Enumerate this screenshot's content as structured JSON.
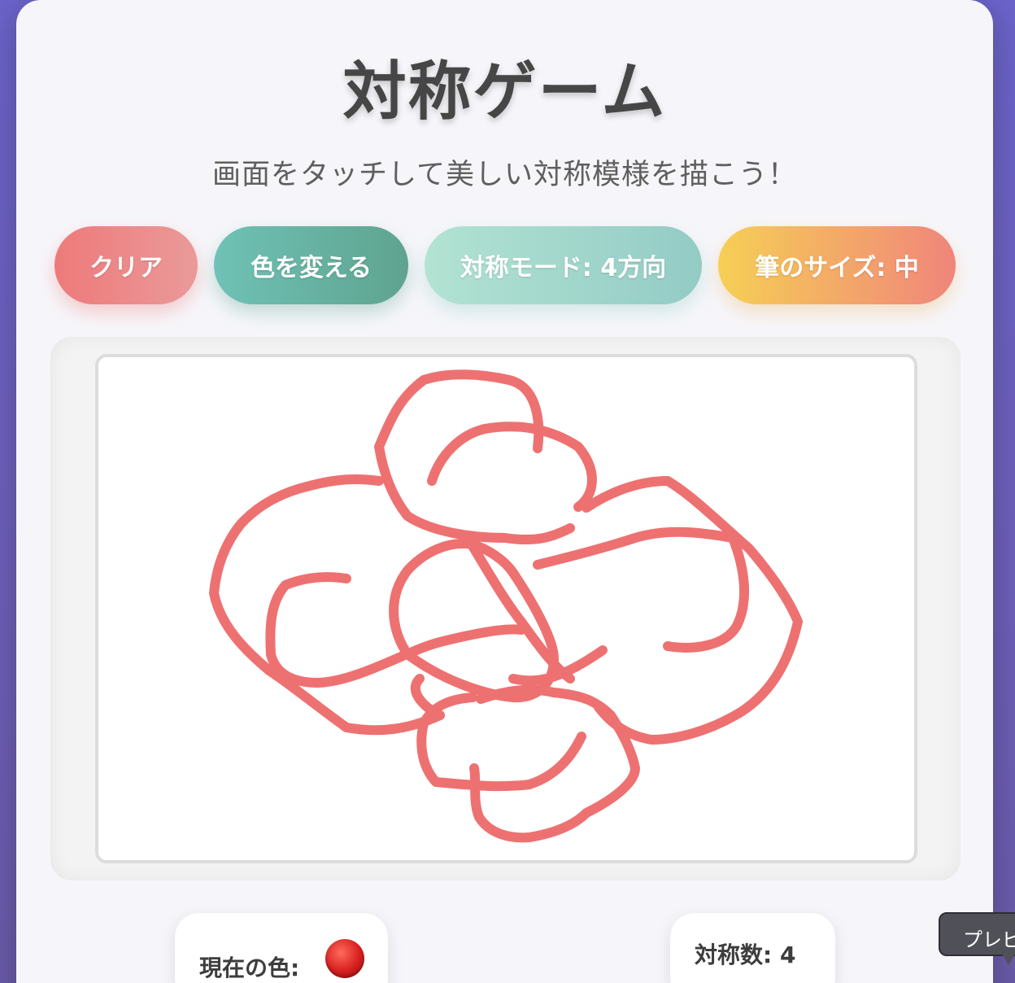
{
  "header": {
    "title": "対称ゲーム",
    "subtitle": "画面をタッチして美しい対称模様を描こう！"
  },
  "toolbar": {
    "clear_label": "クリア",
    "change_color_label": "色を変える",
    "symmetry_mode_label": "対称モード: 4方向",
    "brush_size_label": "筆のサイズ: 中"
  },
  "canvas": {
    "stroke_color": "#ee7171"
  },
  "status": {
    "current_color_label": "現在の色:",
    "current_color_value": "#d61f1f",
    "symmetry_count_label": "対称数: 4"
  },
  "tooltip": {
    "text": "プレビ"
  },
  "colors": {
    "background": "#6b63c9",
    "card": "#f6f6fa",
    "clear_button": "#ee7a7a",
    "color_button": "#5fa38f",
    "mode_button": "#93cbc5",
    "size_button": "#f6cf55"
  }
}
